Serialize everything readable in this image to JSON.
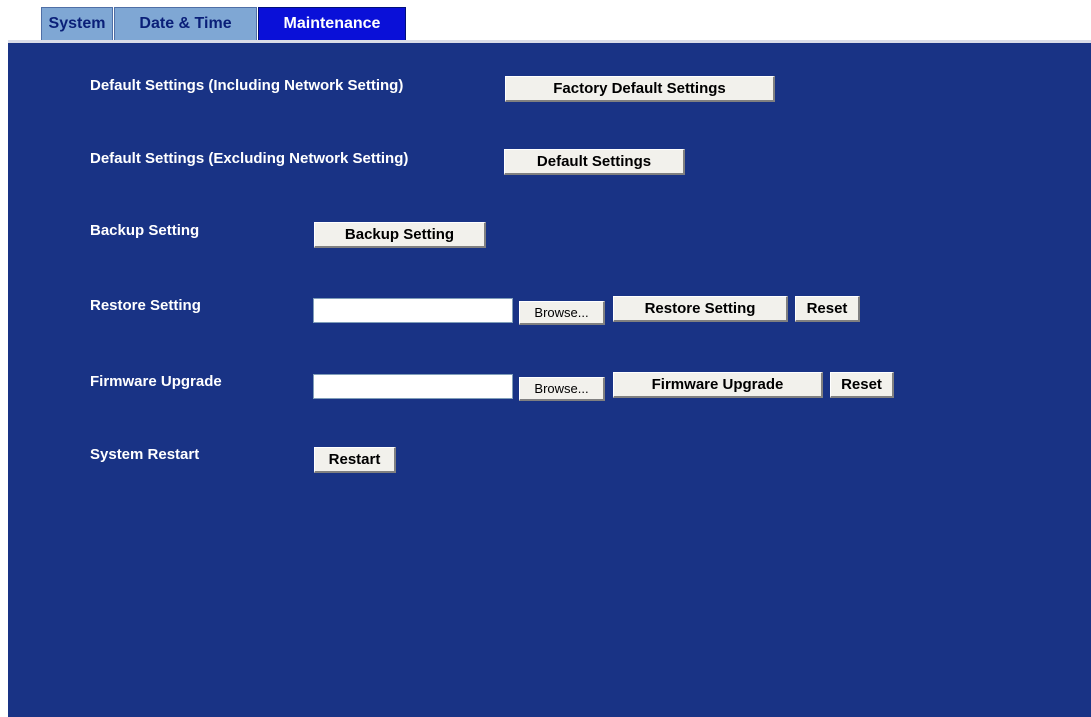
{
  "tabs": [
    {
      "label": "System",
      "active": false
    },
    {
      "label": "Date & Time",
      "active": false
    },
    {
      "label": "Maintenance",
      "active": true
    }
  ],
  "colors": {
    "panel_bg": "#193385",
    "tab_inactive_bg": "#7fa7d4",
    "tab_active_bg": "#0a10d8"
  },
  "rows": {
    "factory": {
      "label": "Default Settings (Including Network Setting)",
      "button": "Factory Default Settings"
    },
    "default": {
      "label": "Default Settings (Excluding Network Setting)",
      "button": "Default Settings"
    },
    "backup": {
      "label": "Backup Setting",
      "button": "Backup Setting"
    },
    "restore": {
      "label": "Restore Setting",
      "file_value": "",
      "browse": "Browse...",
      "button": "Restore Setting",
      "reset": "Reset"
    },
    "firmware": {
      "label": "Firmware Upgrade",
      "file_value": "",
      "browse": "Browse...",
      "button": "Firmware Upgrade",
      "reset": "Reset"
    },
    "restart": {
      "label": "System Restart",
      "button": "Restart"
    }
  }
}
